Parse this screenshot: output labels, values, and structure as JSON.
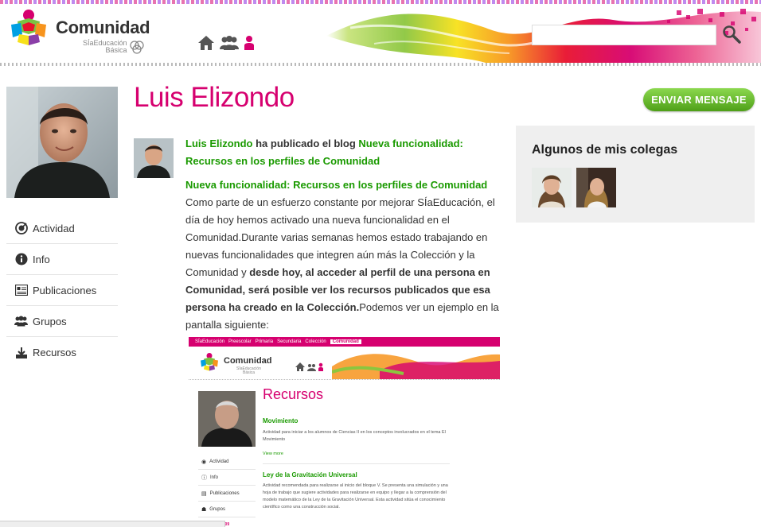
{
  "header": {
    "brand": "Comunidad",
    "brand_sub_1": "SÍaEducación",
    "brand_sub_2": "Básica",
    "search_placeholder": "",
    "nav_icons": [
      "home-icon",
      "groups-icon",
      "person-icon"
    ]
  },
  "profile": {
    "name": "Luis Elizondo",
    "send_message": "ENVIAR MENSAJE"
  },
  "sidebar": {
    "items": [
      {
        "label": "Actividad",
        "icon": "activity-icon"
      },
      {
        "label": "Info",
        "icon": "info-icon"
      },
      {
        "label": "Publicaciones",
        "icon": "publications-icon"
      },
      {
        "label": "Grupos",
        "icon": "groups-icon"
      },
      {
        "label": "Recursos",
        "icon": "resources-icon"
      }
    ]
  },
  "post": {
    "author": "Luis Elizondo",
    "action": " ha publicado el blog ",
    "blog_title": "Nueva funcionalidad: Recursos en los perfiles de Comunidad",
    "title": "Nueva funcionalidad: Recursos en los perfiles de Comunidad",
    "text_1": "Como parte de un esfuerzo constante por mejorar SÍaEducación, el día de hoy hemos activado una nueva funcionalidad en el Comunidad.Durante varias semanas hemos estado trabajando en nuevas funcionalidades que integren aún más la Colección y la Comunidad y ",
    "text_bold": "desde hoy, al acceder al perfil de una persona en Comunidad, será posible ver los recursos publicados que esa persona ha creado en la Colección.",
    "text_2": "Podemos ver un ejemplo en la pantalla siguiente:"
  },
  "embed": {
    "topbar": [
      "SÍaEducación",
      "Preescolar",
      "Primaria",
      "Secundaria",
      "Colección",
      "Comunidad"
    ],
    "topbar_active": "Comunidad",
    "brand": "Comunidad",
    "brand_sub_1": "SÍaEducación",
    "brand_sub_2": "Básica",
    "title": "Recursos",
    "item1_title": "Movimiento",
    "item1_text": "Actividad para iniciar a los alumnos de Ciencias II en los conceptos involucrados en el tema El Movimiento",
    "item1_link": "View more",
    "item2_title": "Ley de la Gravitación Universal",
    "item2_text": "Actividad recomendada para realizarse al inicio del bloque V. Se presenta una simulación y una hoja de trabajo que sugiere actividades para realizarse en equipo y llegar a la comprensión del modelo matemático de la Ley de la Gravitación Universal. Esta actividad sitúa el conocimiento científico como una construcción social.",
    "side": [
      "Actividad",
      "Info",
      "Publicaciones",
      "Grupos"
    ],
    "fragment": "1909"
  },
  "colleagues": {
    "title": "Algunos de mis colegas"
  },
  "colors": {
    "accent": "#d6006f",
    "green": "#1a9a00",
    "button_green": "#5fb52a"
  }
}
